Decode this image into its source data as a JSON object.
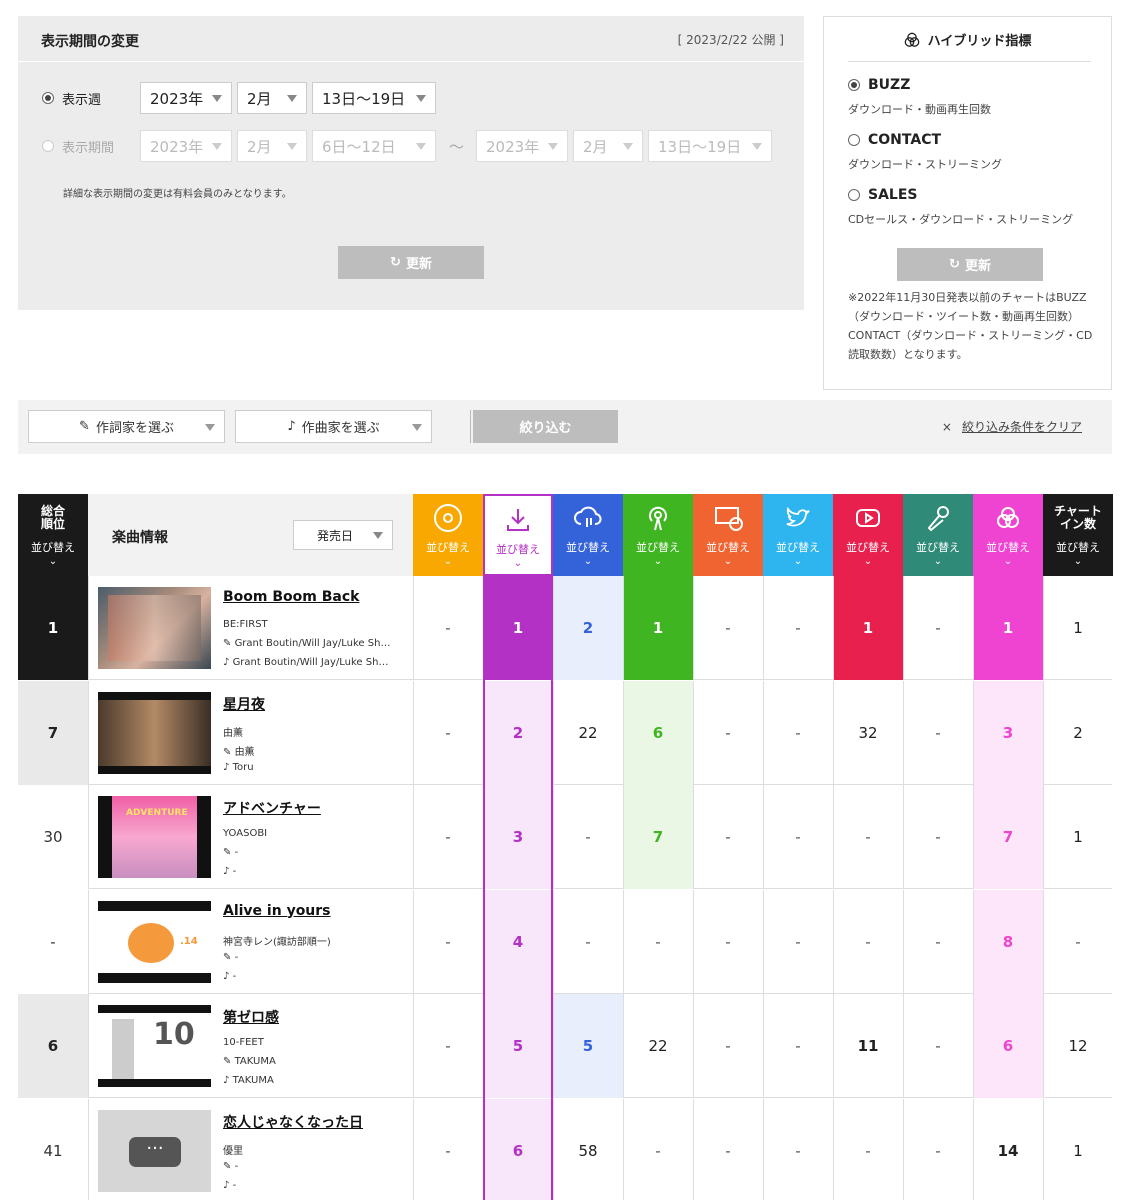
{
  "period": {
    "title": "表示期間の変更",
    "published": "[ 2023/2/22 公開 ]",
    "week_label": "表示週",
    "range_label": "表示期間",
    "week": {
      "year": "2023年",
      "month": "2月",
      "days": "13日〜19日"
    },
    "range_from": {
      "year": "2023年",
      "month": "2月",
      "days": "6日〜12日"
    },
    "tilde": "〜",
    "range_to": {
      "year": "2023年",
      "month": "2月",
      "days": "13日〜19日"
    },
    "note": "詳細な表示期間の変更は有料会員のみとなります。",
    "update_label": "更新"
  },
  "hybrid": {
    "title": "ハイブリッド指標",
    "options": [
      {
        "label": "BUZZ",
        "desc": "ダウンロード・動画再生回数",
        "selected": true
      },
      {
        "label": "CONTACT",
        "desc": "ダウンロード・ストリーミング",
        "selected": false
      },
      {
        "label": "SALES",
        "desc": "CDセールス・ダウンロード・ストリーミング",
        "selected": false
      }
    ],
    "update_label": "更新",
    "note": "※2022年11月30日発表以前のチャートはBUZZ（ダウンロード・ツイート数・動画再生回数）CONTACT（ダウンロード・ストリーミング・CD読取数数）となります。"
  },
  "filter": {
    "lyricist_label": "作詞家を選ぶ",
    "composer_label": "作曲家を選ぶ",
    "apply_label": "絞り込む",
    "clear_label": "絞り込み条件をクリア",
    "clear_icon": "×"
  },
  "table": {
    "rank_header": "総合\n順位",
    "sort_label": "並び替え",
    "song_info_label": "楽曲情報",
    "release_label": "発売日",
    "chart_in_header": "チャート\nイン数",
    "colors": {
      "cd": "#f8a800",
      "download": "#b431c5",
      "streaming": "#3462d9",
      "radio": "#3fb522",
      "tv": "#f06432",
      "twitter": "#2eb4ef",
      "youtube": "#e8204d",
      "karaoke": "#2f8a78",
      "hybrid": "#ef44d2",
      "chartin": "#1a1a1a",
      "rank": "#1a1a1a"
    },
    "rows": [
      {
        "rank": "1",
        "title": "Boom Boom Back",
        "artist": "BE:FIRST",
        "lyricist": "Grant Boutin/Will Jay/Luke Sh…",
        "composer": "Grant Boutin/Will Jay/Luke Sh…",
        "values": [
          "-",
          "1",
          "2",
          "1",
          "-",
          "-",
          "1",
          "-",
          "1",
          "1"
        ]
      },
      {
        "rank": "7",
        "title": "星月夜",
        "artist": "由薫",
        "lyricist": "由薫",
        "composer": "Toru",
        "values": [
          "-",
          "2",
          "22",
          "6",
          "-",
          "-",
          "32",
          "-",
          "3",
          "2"
        ]
      },
      {
        "rank": "30",
        "title": "アドベンチャー",
        "artist": "YOASOBI",
        "lyricist": "-",
        "composer": "-",
        "values": [
          "-",
          "3",
          "-",
          "7",
          "-",
          "-",
          "-",
          "-",
          "7",
          "1"
        ]
      },
      {
        "rank": "-",
        "title": "Alive in yours",
        "artist": "神宮寺レン(諏訪部順一)",
        "lyricist": "-",
        "composer": "-",
        "values": [
          "-",
          "4",
          "-",
          "-",
          "-",
          "-",
          "-",
          "-",
          "8",
          "-"
        ]
      },
      {
        "rank": "6",
        "title": "第ゼロ感",
        "artist": "10-FEET",
        "lyricist": "TAKUMA",
        "composer": "TAKUMA",
        "values": [
          "-",
          "5",
          "5",
          "22",
          "-",
          "-",
          "11",
          "-",
          "6",
          "12"
        ]
      },
      {
        "rank": "41",
        "title": "恋人じゃなくなった日",
        "artist": "優里",
        "lyricist": "-",
        "composer": "-",
        "values": [
          "-",
          "6",
          "58",
          "-",
          "-",
          "-",
          "-",
          "-",
          "14",
          "1"
        ]
      }
    ]
  }
}
